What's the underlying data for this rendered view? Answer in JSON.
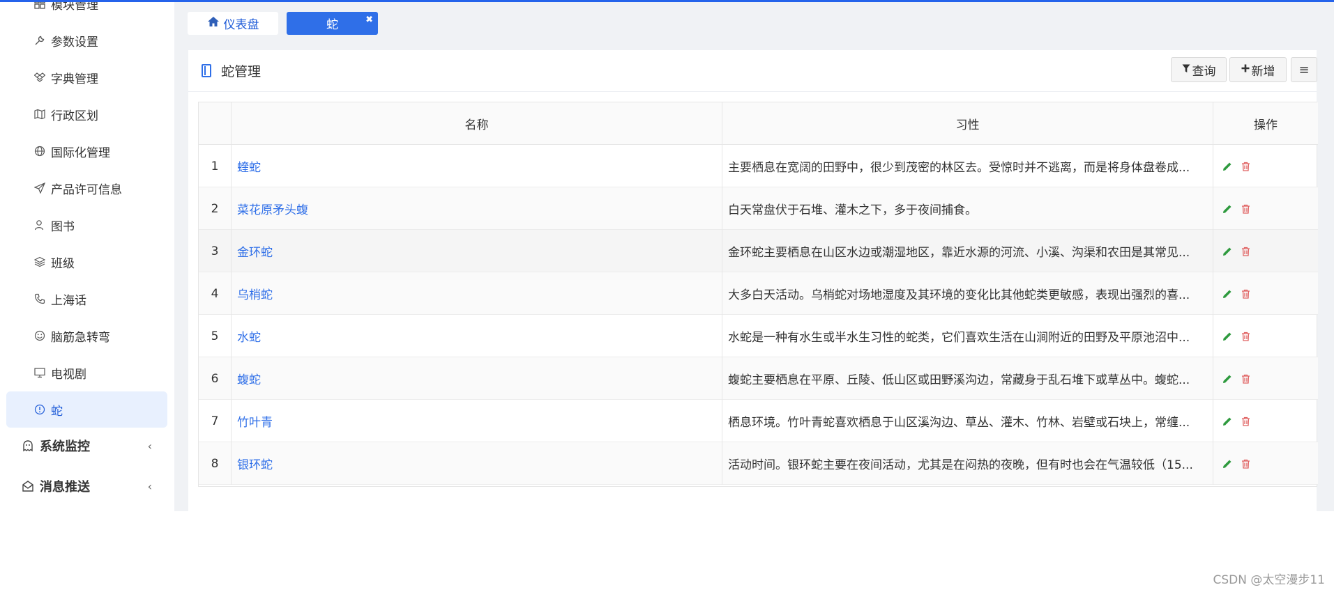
{
  "colors": {
    "accent": "#2f6fe8",
    "topbar": "#2563eb",
    "edit": "#2e9a3e",
    "delete": "#e06060"
  },
  "sidebar": {
    "items": [
      {
        "label": "模块管理",
        "icon": "grid-icon"
      },
      {
        "label": "参数设置",
        "icon": "wrench-icon"
      },
      {
        "label": "字典管理",
        "icon": "dropbox-icon"
      },
      {
        "label": "行政区划",
        "icon": "map-icon"
      },
      {
        "label": "国际化管理",
        "icon": "globe-icon"
      },
      {
        "label": "产品许可信息",
        "icon": "paper-plane-icon"
      },
      {
        "label": "图书",
        "icon": "user-book-icon"
      },
      {
        "label": "班级",
        "icon": "layers-icon"
      },
      {
        "label": "上海话",
        "icon": "phone-icon"
      },
      {
        "label": "脑筋急转弯",
        "icon": "smile-icon"
      },
      {
        "label": "电视剧",
        "icon": "monitor-icon"
      },
      {
        "label": "蛇",
        "icon": "info-circle-icon",
        "active": true
      }
    ],
    "groups": [
      {
        "label": "系统监控",
        "icon": "ghost-icon"
      },
      {
        "label": "消息推送",
        "icon": "envelope-open-icon"
      }
    ]
  },
  "tabs": [
    {
      "label": "仪表盘",
      "icon": "home-icon"
    },
    {
      "label": "蛇",
      "active": true,
      "close": "✖"
    }
  ],
  "card": {
    "title": "蛇管理",
    "buttons": {
      "query": "查询",
      "add": "新增",
      "menu": "≡"
    }
  },
  "table": {
    "columns": [
      "",
      "名称",
      "习性",
      "操作"
    ],
    "rows": [
      {
        "index": "1",
        "name": "蝰蛇",
        "habit": "主要栖息在宽阔的田野中，很少到茂密的林区去。受惊时并不逃离，而是将身体盘卷成..."
      },
      {
        "index": "2",
        "name": "菜花原矛头蝮",
        "habit": "白天常盘伏于石堆、灌木之下，多于夜间捕食。"
      },
      {
        "index": "3",
        "name": "金环蛇",
        "habit": "金环蛇主要栖息在山区水边或潮湿地区，靠近水源的河流、小溪、沟渠和农田是其常见..."
      },
      {
        "index": "4",
        "name": "乌梢蛇",
        "habit": "大多白天活动。乌梢蛇对场地湿度及其环境的变化比其他蛇类更敏感，表现出强烈的喜..."
      },
      {
        "index": "5",
        "name": "水蛇",
        "habit": "水蛇是一种有水生或半水生习性的蛇类，它们喜欢生活在山涧附近的田野及平原池沼中..."
      },
      {
        "index": "6",
        "name": "蝮蛇",
        "habit": "蝮蛇主要栖息在平原、丘陵、低山区或田野溪沟边，常藏身于乱石堆下或草丛中。蝮蛇..."
      },
      {
        "index": "7",
        "name": "竹叶青",
        "habit": "栖息环境。竹叶青蛇喜欢栖息于山区溪沟边、草丛、灌木、竹林、岩壁或石块上，常缠..."
      },
      {
        "index": "8",
        "name": "银环蛇",
        "habit": "活动时间。银环蛇主要在夜间活动，尤其是在闷热的夜晚，但有时也会在气温较低（15..."
      }
    ]
  },
  "watermark": "CSDN @太空漫步11"
}
